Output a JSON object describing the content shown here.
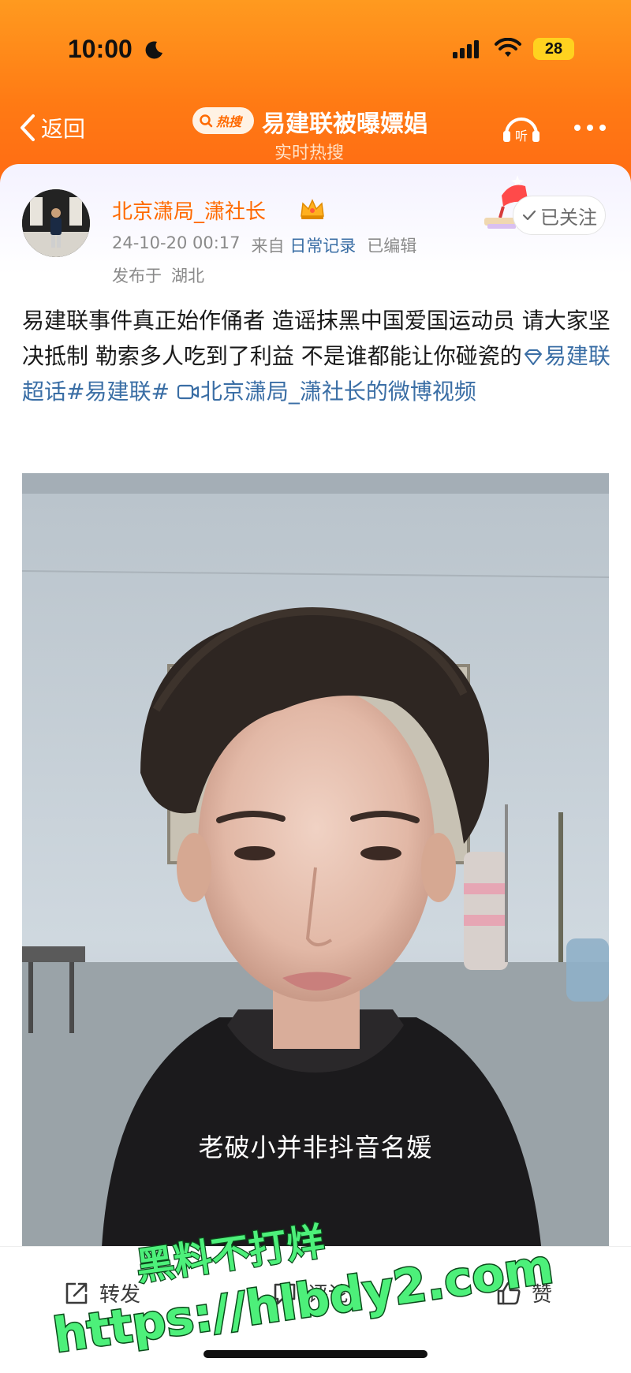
{
  "status_bar": {
    "time": "10:00",
    "battery": "28"
  },
  "nav": {
    "back_label": "返回",
    "hot_badge": "热搜",
    "title": "易建联被曝嫖娼",
    "subtitle": "实时热搜",
    "listen_label": "听"
  },
  "post": {
    "username": "北京潇局_潇社长",
    "date": "24-10-20 00:17",
    "source_prefix": "来自",
    "source": "日常记录",
    "edited": "已编辑",
    "location_prefix": "发布于",
    "location": "湖北",
    "follow_label": "已关注",
    "text_main": "易建联事件真正始作俑者 造谣抹黑中国爱国运动员 请大家坚决抵制 勒索多人吃到了利益 不是谁都能让你碰瓷的",
    "supertopic": "易建联超话",
    "hashtag": "#易建联#",
    "video_link": "北京潇局_潇社长的微博视频",
    "video_subtitle": "老破小并非抖音名媛"
  },
  "actions": {
    "repost": "转发",
    "comment": "评论",
    "like": "赞"
  },
  "watermark": {
    "line1": "黑料不打烊",
    "line2": "https://hlbdy2.com"
  },
  "colors": {
    "header_orange": "#ff7a14",
    "username_orange": "#ff6a00",
    "link_blue": "#3a6ea5",
    "watermark_green": "#4df07a"
  }
}
